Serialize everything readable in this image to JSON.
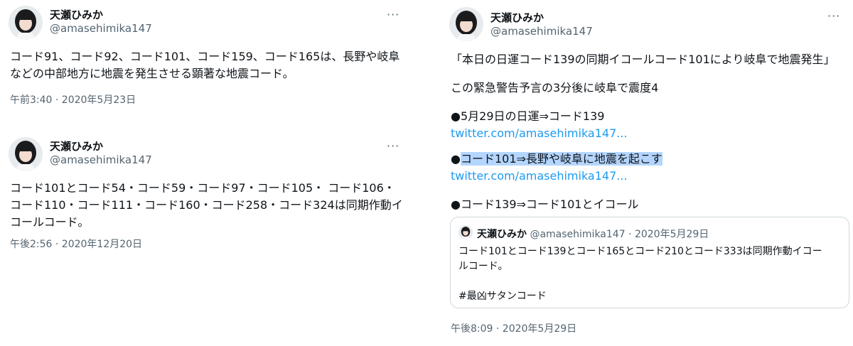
{
  "colors": {
    "text": "#0f1419",
    "secondary": "#536471",
    "link": "#1d9bf0",
    "highlight": "#b4d5fe",
    "border": "#cfd9de"
  },
  "tweets": [
    {
      "name": "天瀬ひみか",
      "handle": "@amasehimika147",
      "more_icon": "more-horizontal-icon",
      "lines": [
        "コード91、コード92、コード101、コード159、コード165は、長野や岐阜",
        "などの中部地方に地震を発生させる顕著な地震コード。"
      ],
      "timestamp": "午前3:40 · 2020年5月23日"
    },
    {
      "name": "天瀬ひみか",
      "handle": "@amasehimika147",
      "more_icon": "more-horizontal-icon",
      "lines": [
        "コード101とコード54・コード59・コード97・コード105・ コード106・",
        "コード110・コード111・コード160・コード258・コード324は同期作動イ",
        "コールコード。"
      ],
      "timestamp": "午後2:56 · 2020年12月20日"
    },
    {
      "name": "天瀬ひみか",
      "handle": "@amasehimika147",
      "more_icon": "more-horizontal-icon",
      "p1": "「本日の日運コード139の同期イコールコード101により岐阜で地震発生」",
      "p2": "この緊急警告予言の3分後に岐阜で震度4",
      "p3": "●5月29日の日運⇒コード139",
      "link1": "twitter.com/amasehimika147...",
      "p4_bullet": "●",
      "p4_highlight": "コード101⇒長野や岐阜に地震を起こす",
      "link2": "twitter.com/amasehimika147...",
      "p5": "●コード139⇒コード101とイコール",
      "quote": {
        "name": "天瀬ひみか",
        "handle_date": "@amasehimika147 · 2020年5月29日",
        "lines": [
          "コード101とコード139とコード165とコード210とコード333は同期作動イコー",
          "ルコード。"
        ],
        "hashtag": "#最凶サタンコード"
      },
      "timestamp": "午後8:09 · 2020年5月29日"
    }
  ]
}
